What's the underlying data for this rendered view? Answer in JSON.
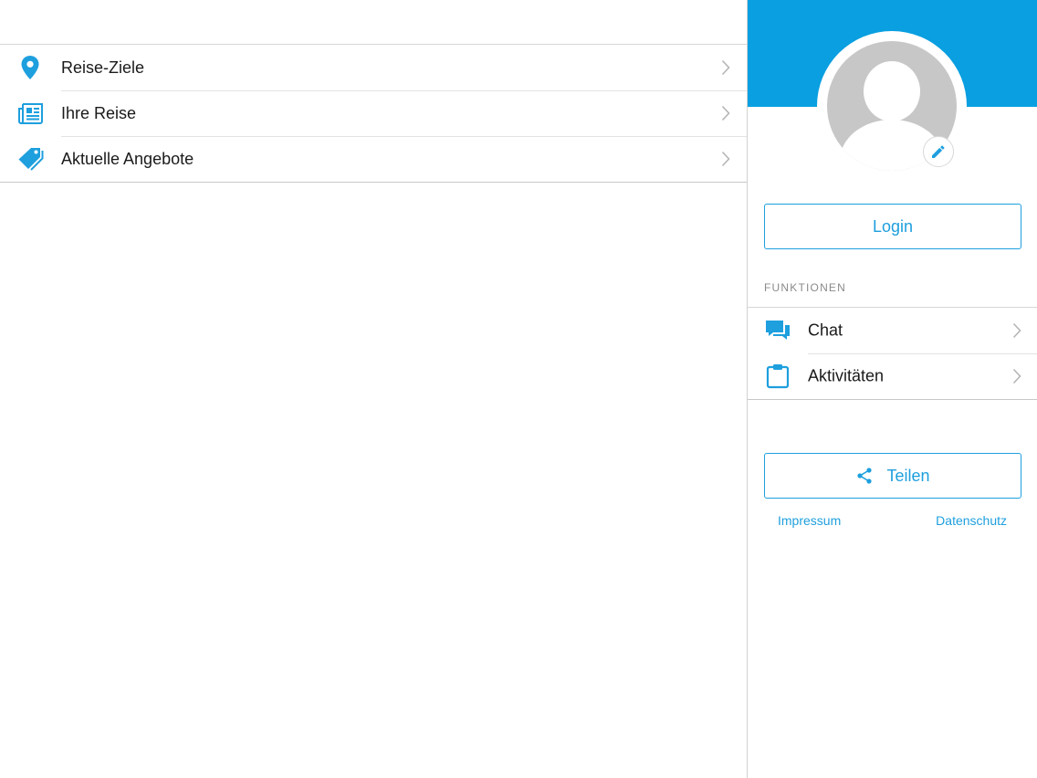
{
  "colors": {
    "accent": "#1e9fde",
    "header_band": "#099fe0",
    "avatar_gray": "#c7c7c7",
    "chevron": "#b5b5b5",
    "section_title": "#8a8a8a"
  },
  "main_menu": {
    "items": [
      {
        "label": "Reise-Ziele",
        "icon": "location-pin-icon"
      },
      {
        "label": "Ihre Reise",
        "icon": "newspaper-icon"
      },
      {
        "label": "Aktuelle Angebote",
        "icon": "tags-icon"
      }
    ]
  },
  "profile": {
    "avatar_icon": "user-placeholder-icon",
    "edit_icon": "pencil-icon",
    "login_label": "Login"
  },
  "functions": {
    "title": "FUNKTIONEN",
    "items": [
      {
        "label": "Chat",
        "icon": "chat-bubbles-icon"
      },
      {
        "label": "Aktivitäten",
        "icon": "clipboard-icon"
      }
    ]
  },
  "share": {
    "label": "Teilen",
    "icon": "share-icon"
  },
  "footer": {
    "impressum": "Impressum",
    "datenschutz": "Datenschutz"
  }
}
